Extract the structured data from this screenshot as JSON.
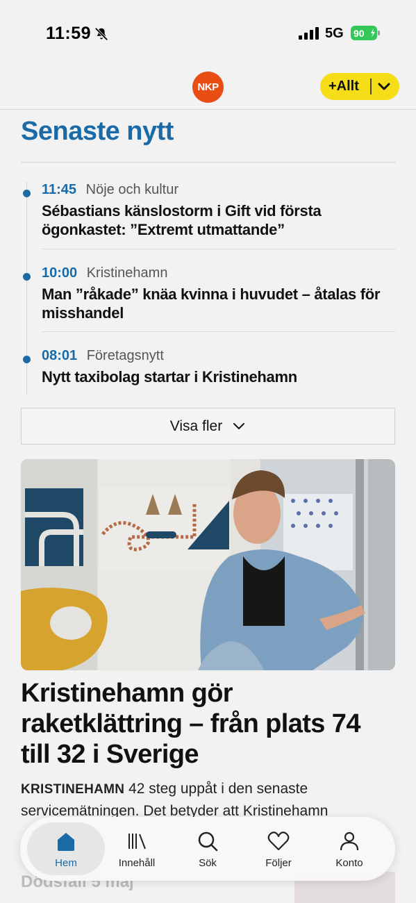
{
  "status_bar": {
    "time": "11:59",
    "network": "5G",
    "battery": "90"
  },
  "header": {
    "logo_text": "NKP",
    "plus_button": "+Allt"
  },
  "section": {
    "title": "Senaste nytt"
  },
  "news": [
    {
      "time": "11:45",
      "category": "Nöje och kultur",
      "title": "Sébastians känslostorm i Gift vid första ögonkastet: ”Extremt utmattande”"
    },
    {
      "time": "10:00",
      "category": "Kristinehamn",
      "title": "Man ”råkade” knäa kvinna i huvudet – åtalas för misshandel"
    },
    {
      "time": "08:01",
      "category": "Företagsnytt",
      "title": "Nytt taxibolag startar i Kristinehamn"
    }
  ],
  "more_button": "Visa fler",
  "article": {
    "title": "Kristinehamn gör raketklättring – från plats 74 till 32 i Sverige",
    "kicker": "KRISTINEHAMN",
    "lead": "42 steg uppåt i den senaste servicemätningen. Det betyder att Kristinehamn"
  },
  "below_fold": {
    "faded_heading": "Dödsfall 5 maj"
  },
  "tabs": [
    {
      "label": "Hem",
      "icon": "home-icon",
      "active": true
    },
    {
      "label": "Innehåll",
      "icon": "library-icon",
      "active": false
    },
    {
      "label": "Sök",
      "icon": "search-icon",
      "active": false
    },
    {
      "label": "Följer",
      "icon": "heart-icon",
      "active": false
    },
    {
      "label": "Konto",
      "icon": "person-icon",
      "active": false
    }
  ],
  "colors": {
    "accent": "#1a6aa8",
    "logo": "#e84e14",
    "plus": "#f5dd18",
    "battery": "#34c759"
  }
}
